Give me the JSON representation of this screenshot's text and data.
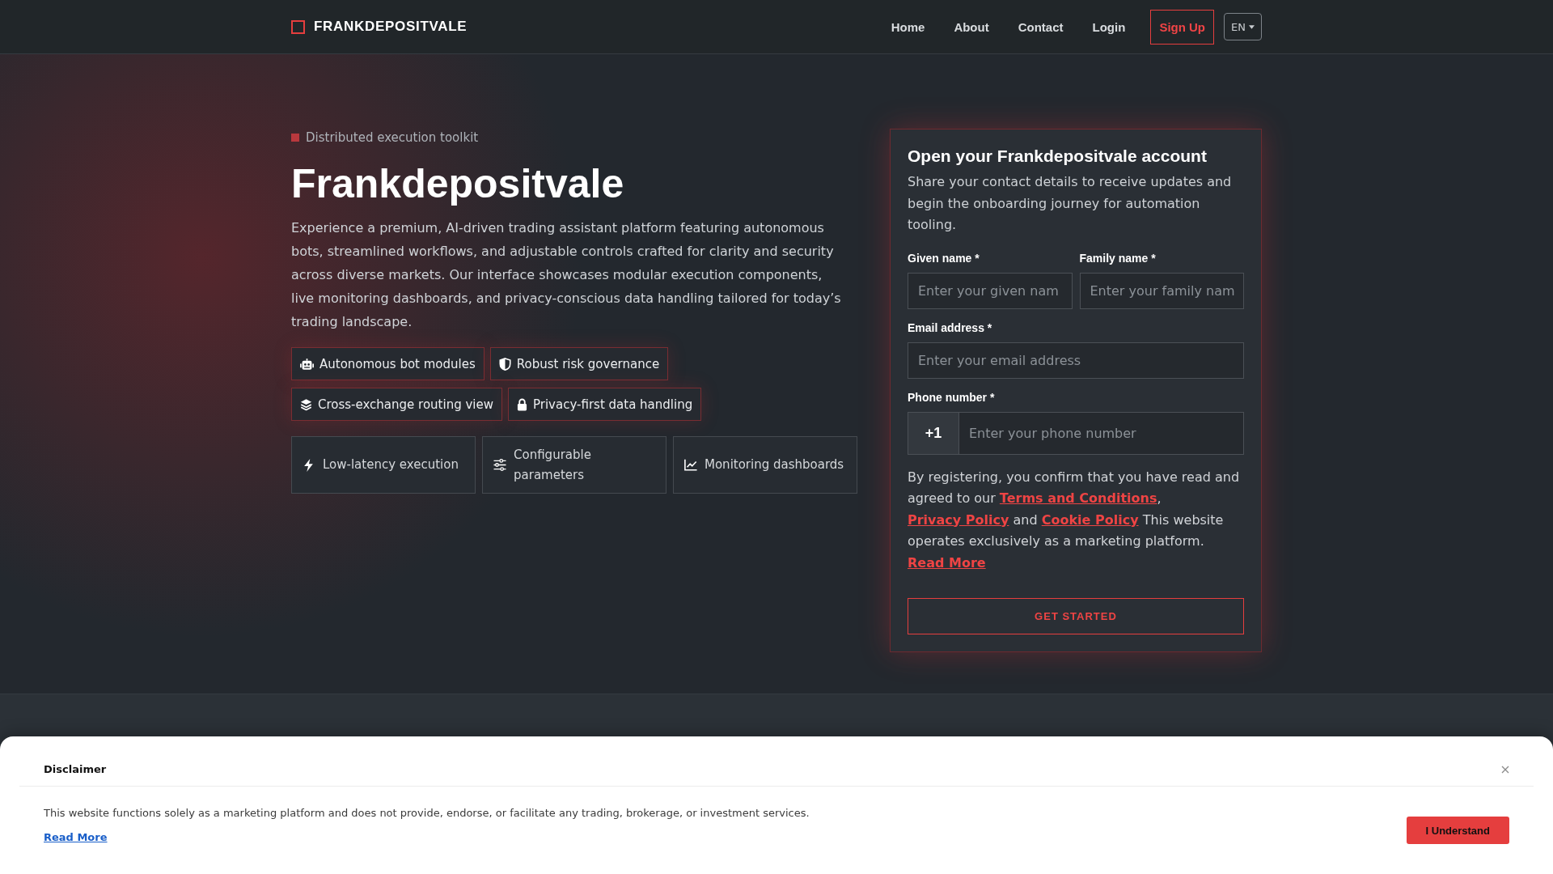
{
  "header": {
    "logo": "FRANKDEPOSITVALE",
    "nav": [
      {
        "label": "Home",
        "kind": "link"
      },
      {
        "label": "About",
        "kind": "link"
      },
      {
        "label": "Contact",
        "kind": "link"
      },
      {
        "label": "Login",
        "kind": "link"
      },
      {
        "label": "Sign Up",
        "kind": "button"
      }
    ],
    "language": "EN"
  },
  "hero": {
    "tagline": "Distributed execution toolkit",
    "title": "Frankdepositvale",
    "description": "Experience a premium, AI-driven trading assistant platform featuring autonomous bots, streamlined workflows, and adjustable controls crafted for clarity and security across diverse markets. Our interface showcases modular execution components, live monitoring dashboards, and privacy-conscious data handling tailored for today’s trading landscape.",
    "tags": [
      "Autonomous bot modules",
      "Robust risk governance",
      "Cross-exchange routing view",
      "Privacy-first data handling"
    ],
    "features": [
      "Low-latency execution",
      "Configurable parameters",
      "Monitoring dashboards"
    ]
  },
  "signup_form": {
    "title": "Open your Frankdepositvale account",
    "description": "Share your contact details to receive updates and begin the onboarding journey for automation tooling.",
    "rows": [
      [
        {
          "kind": "text",
          "label": "Given name *",
          "placeholder": "Enter your given nam"
        },
        {
          "kind": "text",
          "label": "Family name *",
          "placeholder": "Enter your family nam"
        }
      ],
      [
        {
          "kind": "text",
          "label": "Email address *",
          "placeholder": "Enter your email address"
        }
      ],
      [
        {
          "kind": "phone",
          "label": "Phone number *",
          "prefix": "+1",
          "placeholder": "Enter your phone number"
        }
      ]
    ],
    "consent": [
      {
        "kind": "text",
        "text": "By registering, you confirm that you have read and agreed to our "
      },
      {
        "kind": "link",
        "text": "Terms and Conditions"
      },
      {
        "kind": "text",
        "text": ", "
      },
      {
        "kind": "link",
        "text": "Privacy Policy"
      },
      {
        "kind": "text",
        "text": " and "
      },
      {
        "kind": "link",
        "text": "Cookie Policy"
      },
      {
        "kind": "text",
        "text": " This website operates exclusively as a marketing platform. "
      },
      {
        "kind": "link",
        "text": "Read More"
      }
    ],
    "submit": "GET STARTED"
  },
  "disclaimer": {
    "title": "Disclaimer",
    "text": "This website functions solely as a marketing platform and does not provide, endorse, or facilitate any trading, brokerage, or investment services.",
    "link": "Read More",
    "button": "I Understand"
  }
}
